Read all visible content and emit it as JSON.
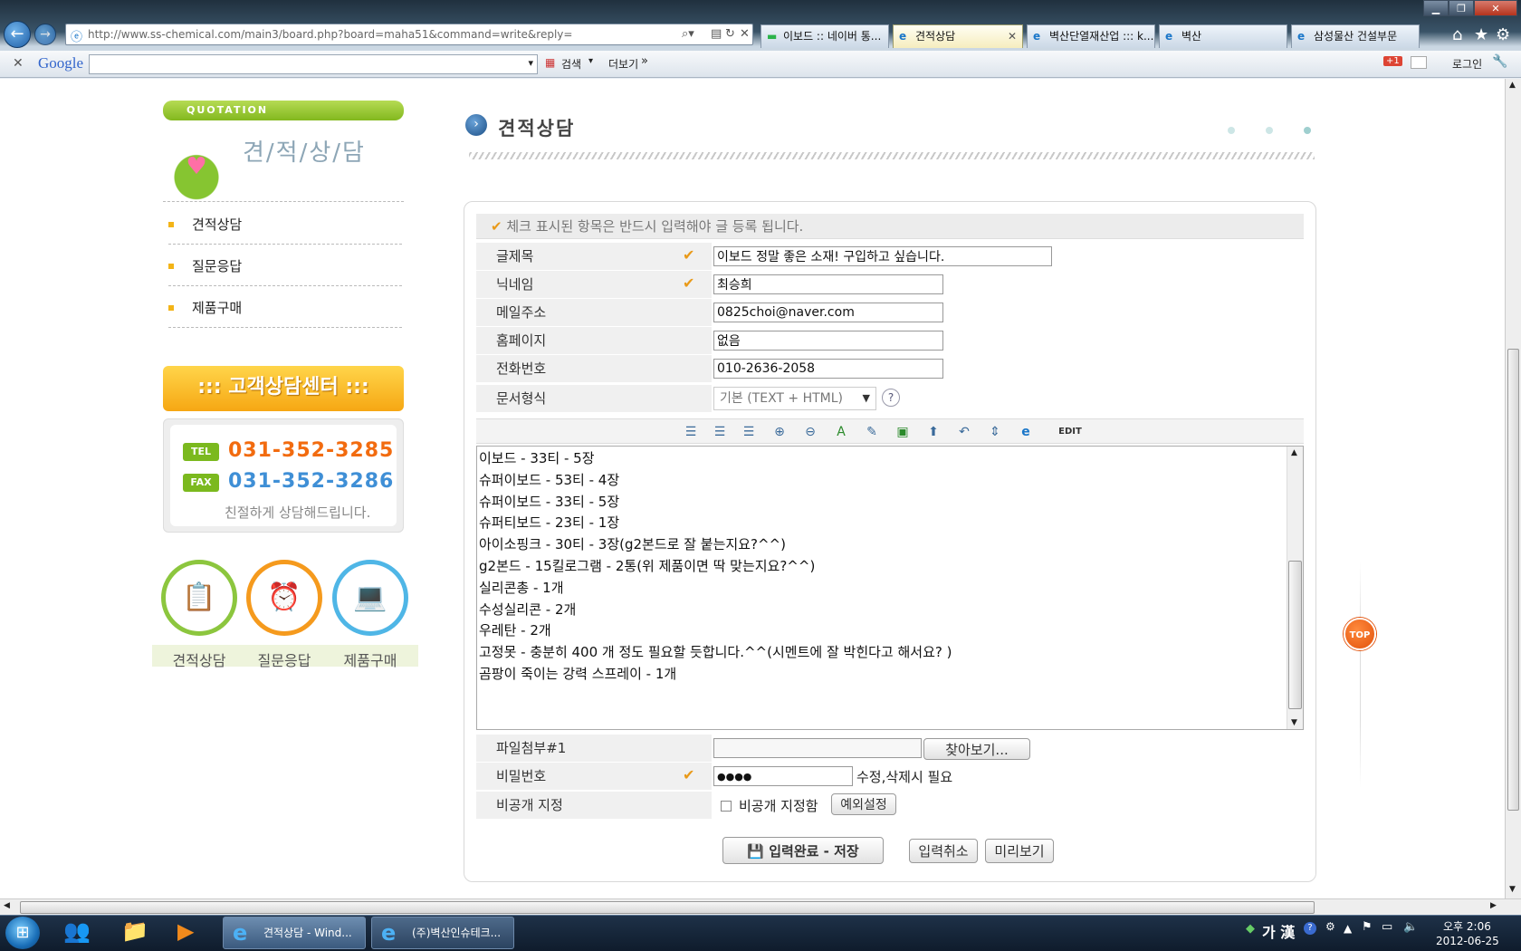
{
  "browser": {
    "url": "http://www.ss-chemical.com/main3/board.php?board=maha51&command=write&reply=",
    "tabs": [
      {
        "label": "이보드 :: 네이버 통..."
      },
      {
        "label": "견적상담"
      },
      {
        "label": "벽산단열재산업 ::: k..."
      },
      {
        "label": "벽산"
      },
      {
        "label": "삼성물산 건설부문"
      }
    ],
    "google": {
      "logo": "Google",
      "search_label": "검색",
      "more_label": "더보기",
      "login_label": "로그인",
      "plus_badge": "+1"
    }
  },
  "sidebar": {
    "header": "QUOTATION",
    "title": "견/적/상/담",
    "menu": [
      {
        "label": "견적상담"
      },
      {
        "label": "질문응답"
      },
      {
        "label": "제품구매"
      }
    ],
    "center_banner": "::: 고객상담센터 :::",
    "tel_badge": "TEL",
    "tel": "031-352-3285",
    "fax_badge": "FAX",
    "fax": "031-352-3286",
    "note": "친절하게 상담해드립니다.",
    "quick": [
      {
        "label": "견적상담"
      },
      {
        "label": "질문응답"
      },
      {
        "label": "제품구매"
      }
    ]
  },
  "main": {
    "title": "견적상담",
    "notice": "체크 표시된 항목은 반드시 입력해야 글 등록 됩니다.",
    "fields": {
      "subject": {
        "label": "글제목",
        "value": "이보드 정말 좋은 소재! 구입하고 싶습니다."
      },
      "nickname": {
        "label": "닉네임",
        "value": "최승희"
      },
      "email": {
        "label": "메일주소",
        "value": "0825choi@naver.com"
      },
      "homepage": {
        "label": "홈페이지",
        "value": "없음"
      },
      "phone": {
        "label": "전화번호",
        "value": "010-2636-2058"
      },
      "doc_format": {
        "label": "문서형식",
        "value": "기본 (TEXT + HTML)"
      },
      "attach": {
        "label": "파일첨부#1",
        "value": "",
        "browse_label": "찾아보기..."
      },
      "password": {
        "label": "비밀번호",
        "value": "●●●●",
        "note": "수정,삭제시 필요"
      },
      "private": {
        "label": "비공개 지정",
        "checkbox_label": "비공개 지정함",
        "exception_label": "예외설정"
      }
    },
    "editor": {
      "edit_label": "EDIT",
      "lines": [
        "이보드 - 33티 - 5장",
        "슈퍼이보드 - 53티 - 4장",
        "슈퍼이보드 - 33티 - 5장",
        "슈퍼티보드 - 23티 - 1장",
        "아이소핑크 - 30티 - 3장(g2본드로 잘 붙는지요?^^)",
        "g2본드 - 15킬로그램 - 2통(위 제품이면 딱 맞는지요?^^)",
        "실리콘총 - 1개",
        "수성실리콘 - 2개",
        "우레탄 - 2개",
        "고정못 - 충분히 400 개 정도 필요할 듯합니다.^^(시멘트에 잘 박힌다고 해서요? )",
        "곰팡이 죽이는 강력 스프레이 - 1개"
      ]
    },
    "buttons": {
      "submit": "입력완료 - 저장",
      "cancel": "입력취소",
      "preview": "미리보기"
    },
    "top_label": "TOP"
  },
  "taskbar": {
    "items": [
      {
        "label": "견적상담 - Wind..."
      },
      {
        "label": "(주)벽산인슈테크..."
      }
    ],
    "ime": "가 漢",
    "time": "오후 2:06",
    "date": "2012-06-25"
  }
}
